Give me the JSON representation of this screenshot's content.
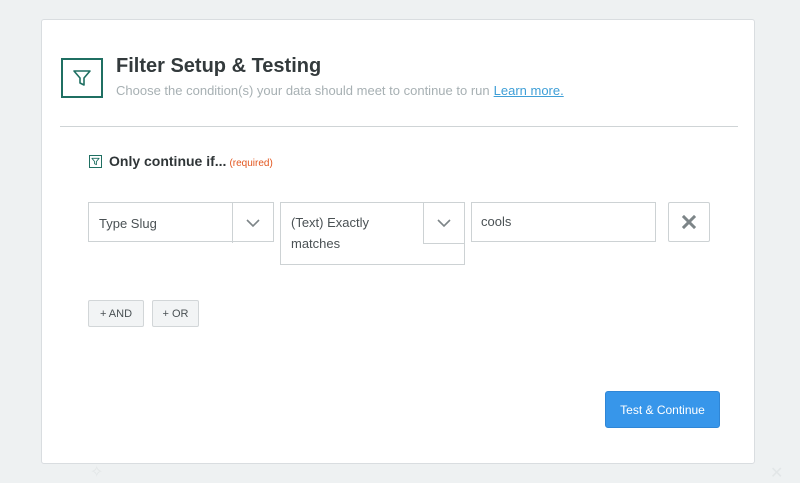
{
  "header": {
    "title": "Filter Setup & Testing",
    "subtitle": "Choose the condition(s) your data should meet to continue to run",
    "learn_more": "Learn more.",
    "icon": "filter-icon"
  },
  "section": {
    "label": "Only continue if...",
    "required": "(required)",
    "icon": "filter-icon"
  },
  "condition": {
    "field": "Type Slug",
    "operator_line1": "(Text) Exactly",
    "operator_line2": "matches",
    "value": "cools",
    "delete_icon": "close-icon"
  },
  "buttons": {
    "and": "+ AND",
    "or": "+ OR",
    "test_continue": "Test & Continue"
  },
  "colors": {
    "accent": "#1f6f62",
    "primary": "#3796ea",
    "required": "#e2561f",
    "link": "#3f9fd7"
  }
}
